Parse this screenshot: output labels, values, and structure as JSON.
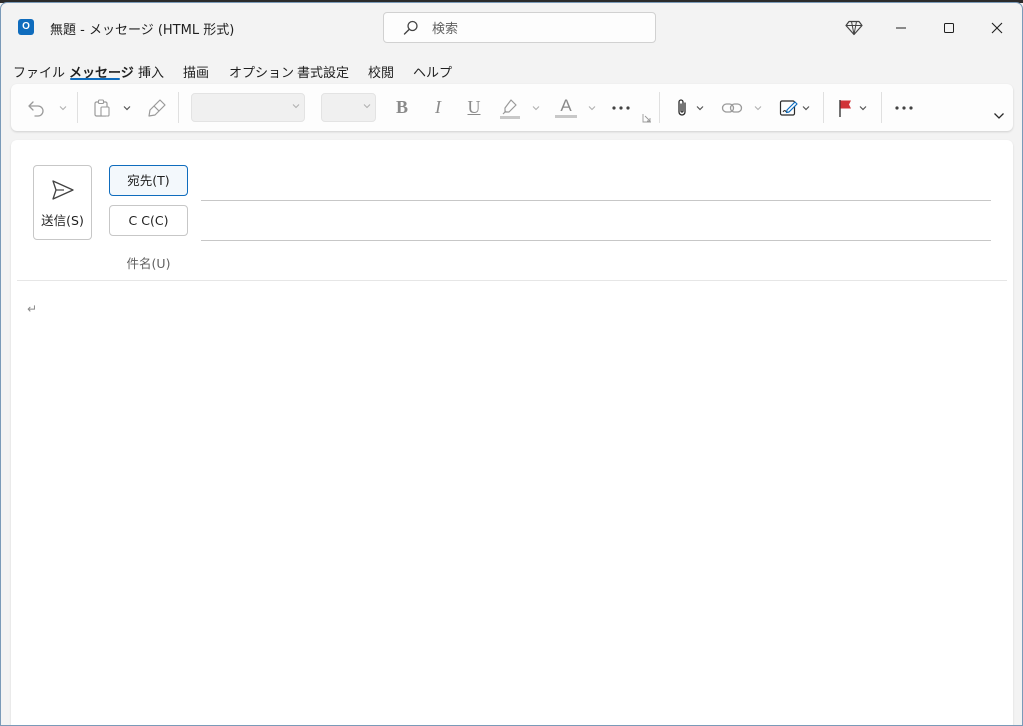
{
  "window": {
    "title": "無題  -  メッセージ (HTML 形式)",
    "app_icon": "outlook-icon",
    "controls": [
      "premium-diamond-icon",
      "minimize-icon",
      "maximize-icon",
      "close-icon"
    ]
  },
  "search": {
    "placeholder": "検索",
    "value": ""
  },
  "menu": {
    "tabs": [
      {
        "label": "ファイル"
      },
      {
        "label": "メッセージ"
      },
      {
        "label": "挿入"
      },
      {
        "label": "描画"
      },
      {
        "label": "オプション"
      },
      {
        "label": "書式設定"
      },
      {
        "label": "校閲"
      },
      {
        "label": "ヘルプ"
      }
    ],
    "active": "メッセージ"
  },
  "ribbon": {
    "font_name": "",
    "font_size": "",
    "bold": "B",
    "italic": "I",
    "underline": "U",
    "font_color_letter": "A",
    "highlight_color": "#ffd400",
    "font_color": "#c00000",
    "flag_color": "#d13438",
    "icons": [
      "undo-icon",
      "paste-icon",
      "format-painter-icon",
      "more-icon",
      "attach-icon",
      "link-icon",
      "signature-icon",
      "flag-icon",
      "more-icon",
      "expand-ribbon-icon"
    ]
  },
  "compose": {
    "send_label": "送信(S)",
    "to_label": "宛先(T)",
    "cc_label": "C C(C)",
    "subject_label": "件名(U)",
    "to_value": "",
    "cc_value": "",
    "subject_value": "",
    "body_mark": "↵"
  },
  "colors": {
    "accent": "#0f6cbd",
    "background": "#f3f3f3",
    "surface": "#ffffff"
  }
}
